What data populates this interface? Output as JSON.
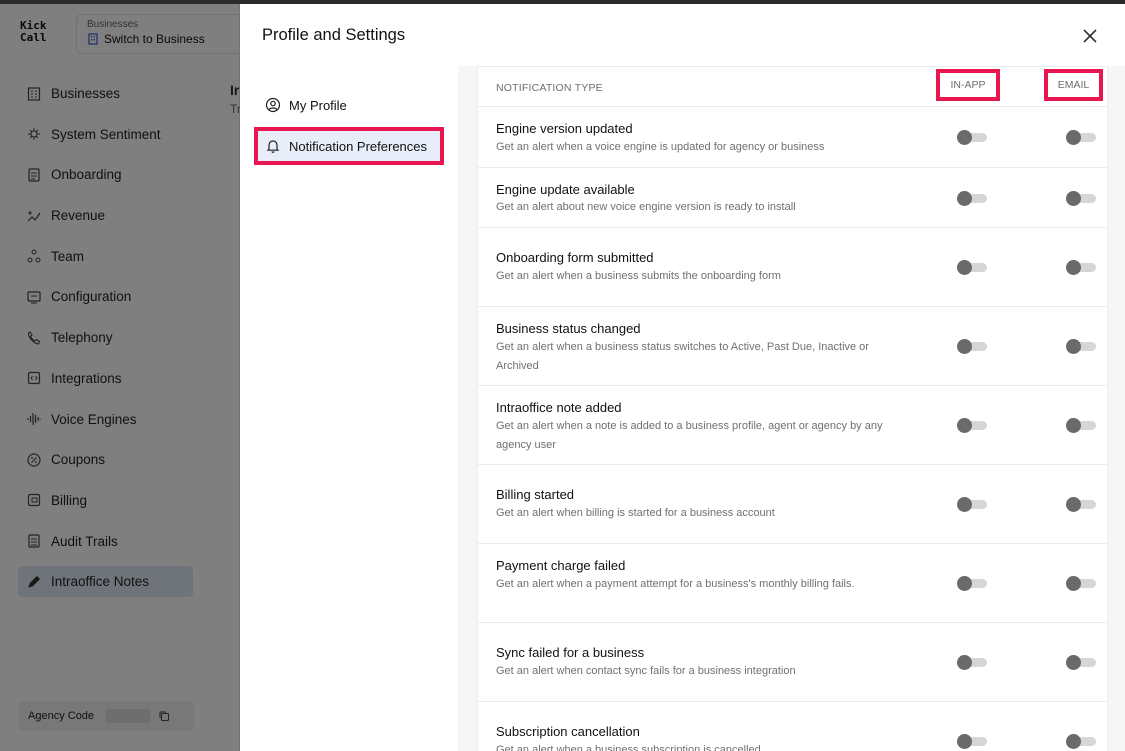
{
  "app": {
    "logo": [
      "Kick",
      "Call"
    ],
    "business_switch": {
      "caption": "Businesses",
      "label": "Switch to Business"
    },
    "nav": [
      {
        "label": "Businesses",
        "icon": "building-icon"
      },
      {
        "label": "System Sentiment",
        "icon": "sentiment-icon"
      },
      {
        "label": "Onboarding",
        "icon": "document-icon"
      },
      {
        "label": "Revenue",
        "icon": "revenue-icon"
      },
      {
        "label": "Team",
        "icon": "team-icon"
      },
      {
        "label": "Configuration",
        "icon": "config-icon"
      },
      {
        "label": "Telephony",
        "icon": "phone-icon"
      },
      {
        "label": "Integrations",
        "icon": "integrations-icon"
      },
      {
        "label": "Voice Engines",
        "icon": "waveform-icon"
      },
      {
        "label": "Coupons",
        "icon": "coupon-icon"
      },
      {
        "label": "Billing",
        "icon": "billing-icon"
      },
      {
        "label": "Audit Trails",
        "icon": "audit-icon"
      },
      {
        "label": "Intraoffice Notes",
        "icon": "pencil-icon",
        "active": true
      }
    ],
    "agency_code_label": "Agency Code",
    "peek_title": "Ir",
    "peek_sub": "Tr"
  },
  "modal": {
    "title": "Profile and Settings",
    "nav": [
      {
        "label": "My Profile",
        "icon": "user-circle-icon"
      },
      {
        "label": "Notification Preferences",
        "icon": "bell-icon",
        "active": true
      }
    ],
    "table": {
      "header_type": "NOTIFICATION TYPE",
      "header_inapp": "IN-APP",
      "header_email": "EMAIL",
      "rows": [
        {
          "title": "Engine version updated",
          "desc": "Get an alert when a voice engine is updated for agency or business",
          "in_app": false,
          "email": false
        },
        {
          "title": "Engine update available",
          "desc": "Get an alert about new voice engine version is ready to install",
          "in_app": false,
          "email": false
        },
        {
          "title": "Onboarding form submitted",
          "desc": "Get an alert when a business submits the onboarding form",
          "in_app": false,
          "email": false
        },
        {
          "title": "Business status changed",
          "desc": "Get an alert when a business status switches to Active, Past Due, Inactive or Archived",
          "in_app": false,
          "email": false
        },
        {
          "title": "Intraoffice note added",
          "desc": "Get an alert when a note is added to a business profile, agent or agency by any agency user",
          "in_app": false,
          "email": false
        },
        {
          "title": "Billing started",
          "desc": "Get an alert when billing is started for a business account",
          "in_app": false,
          "email": false
        },
        {
          "title": "Payment charge failed",
          "desc": "Get an alert when a payment attempt for a business's monthly billing fails.",
          "in_app": false,
          "email": false
        },
        {
          "title": "Sync failed for a business",
          "desc": "Get an alert when contact sync fails for a business integration",
          "in_app": false,
          "email": false
        },
        {
          "title": "Subscription cancellation",
          "desc": "Get an alert when a business subscription is cancelled",
          "in_app": false,
          "email": false
        }
      ]
    }
  }
}
